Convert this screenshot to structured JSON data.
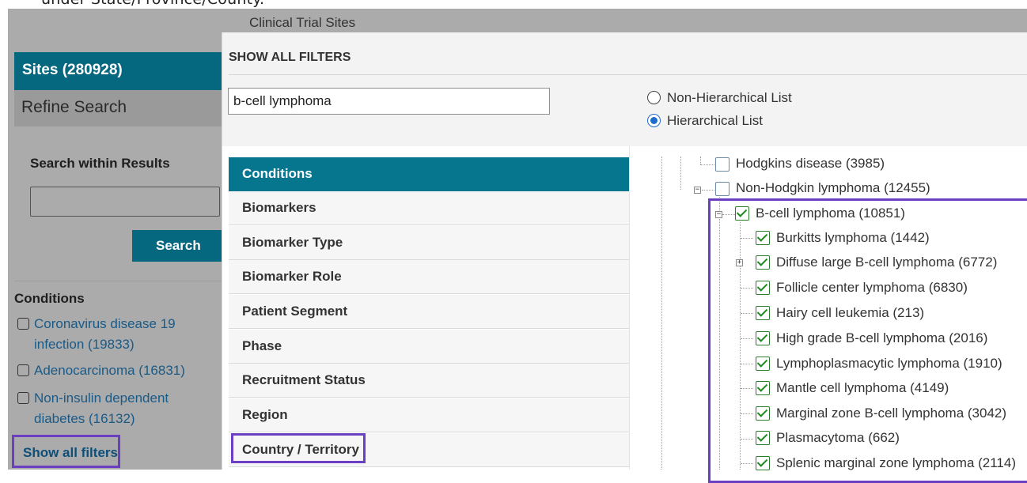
{
  "top_partial_text": "under State/Province/County.",
  "background": {
    "title": "Clinical Trial Sites",
    "sidebar": {
      "sites_header": "Sites (280928)",
      "refine_search": "Refine Search",
      "search_within_label": "Search within Results",
      "search_button": "Search",
      "conditions_heading": "Conditions",
      "conditions": [
        {
          "label": "Coronavirus disease 19 infection (19833)",
          "line1": "Coronavirus disease 19",
          "line2": "infection (19833)"
        },
        {
          "label": "Adenocarcinoma (16831)",
          "line1": "Adenocarcinoma (16831)",
          "line2": ""
        },
        {
          "label": "Non-insulin dependent diabetes (16132)",
          "line1": "Non-insulin dependent",
          "line2": "diabetes (16132)"
        }
      ],
      "show_all_filters": "Show all filters"
    }
  },
  "modal": {
    "title": "SHOW ALL FILTERS",
    "search_value": "b-cell lymphoma",
    "radio_options": [
      {
        "label": "Non-Hierarchical List",
        "checked": false
      },
      {
        "label": "Hierarchical List",
        "checked": true
      }
    ],
    "filter_categories": [
      {
        "label": "Conditions",
        "active": true
      },
      {
        "label": "Biomarkers",
        "active": false
      },
      {
        "label": "Biomarker Type",
        "active": false
      },
      {
        "label": "Biomarker Role",
        "active": false
      },
      {
        "label": "Patient Segment",
        "active": false
      },
      {
        "label": "Phase",
        "active": false
      },
      {
        "label": "Recruitment Status",
        "active": false
      },
      {
        "label": "Region",
        "active": false
      },
      {
        "label": "Country / Territory",
        "active": false
      }
    ],
    "tree": {
      "hodgkins": {
        "label": "Hodgkins disease (3985)",
        "checked": false
      },
      "non_hodgkin": {
        "label": "Non-Hodgkin lymphoma (12455)",
        "checked": false
      },
      "b_cell": {
        "label": "B-cell lymphoma (10851)",
        "checked": true
      },
      "children": [
        {
          "label": "Burkitts lymphoma (1442)",
          "checked": true,
          "expandable": false
        },
        {
          "label": "Diffuse large B-cell lymphoma (6772)",
          "checked": true,
          "expandable": true
        },
        {
          "label": "Follicle center lymphoma (6830)",
          "checked": true,
          "expandable": false
        },
        {
          "label": "Hairy cell leukemia (213)",
          "checked": true,
          "expandable": false
        },
        {
          "label": "High grade B-cell lymphoma (2016)",
          "checked": true,
          "expandable": false
        },
        {
          "label": "Lymphoplasmacytic lymphoma (1910)",
          "checked": true,
          "expandable": false
        },
        {
          "label": "Mantle cell lymphoma (4149)",
          "checked": true,
          "expandable": false
        },
        {
          "label": "Marginal zone B-cell lymphoma (3042)",
          "checked": true,
          "expandable": false
        },
        {
          "label": "Plasmacytoma (662)",
          "checked": true,
          "expandable": false
        },
        {
          "label": "Splenic marginal zone lymphoma (2114)",
          "checked": true,
          "expandable": false
        }
      ]
    }
  },
  "colors": {
    "teal": "#06687e",
    "highlight": "#6a3fc1",
    "check": "#1e8a1e"
  }
}
